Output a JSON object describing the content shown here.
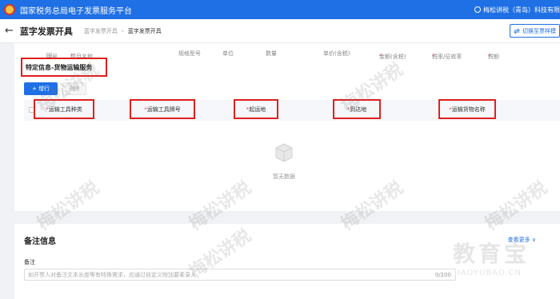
{
  "topbar": {
    "title": "国家税务总局电子发票服务平台",
    "user": "梅松讲税（青岛）科技有限"
  },
  "navbar": {
    "title": "蓝字发票开具",
    "crumb_1": "蓝字发票开具",
    "crumb_sep": "›",
    "crumb_2": "蓝字发票开具",
    "switch": "切换至票样模"
  },
  "table_header": {
    "columns": [
      "序号",
      "项目名称",
      "规格型号",
      "单位",
      "数量",
      "单价(含税)",
      "金额(含税)",
      "税率/征收率",
      "税额"
    ]
  },
  "special": {
    "label": "特定信息-货物运输服务"
  },
  "buttons": {
    "add": "+ 增行",
    "delete": "删除"
  },
  "transport_columns": [
    "运输工具种类",
    "运输工具牌号",
    "起运地",
    "到达地",
    "运输货物名称"
  ],
  "empty": {
    "text": "暂无数据"
  },
  "remark": {
    "title": "备注信息",
    "more": "查看更多 ∨",
    "label": "备注",
    "placeholder": "如开票人对备注文本长度等有特殊需求，应通过自定义附加要素录入",
    "count": "0/200"
  },
  "watermark": {
    "text": "梅松讲税"
  },
  "brand": {
    "main": "教育宝",
    "sub": "JIAOYUBAO.CN"
  },
  "colors": {
    "primary": "#1f6fe5",
    "highlight": "#e02020"
  }
}
